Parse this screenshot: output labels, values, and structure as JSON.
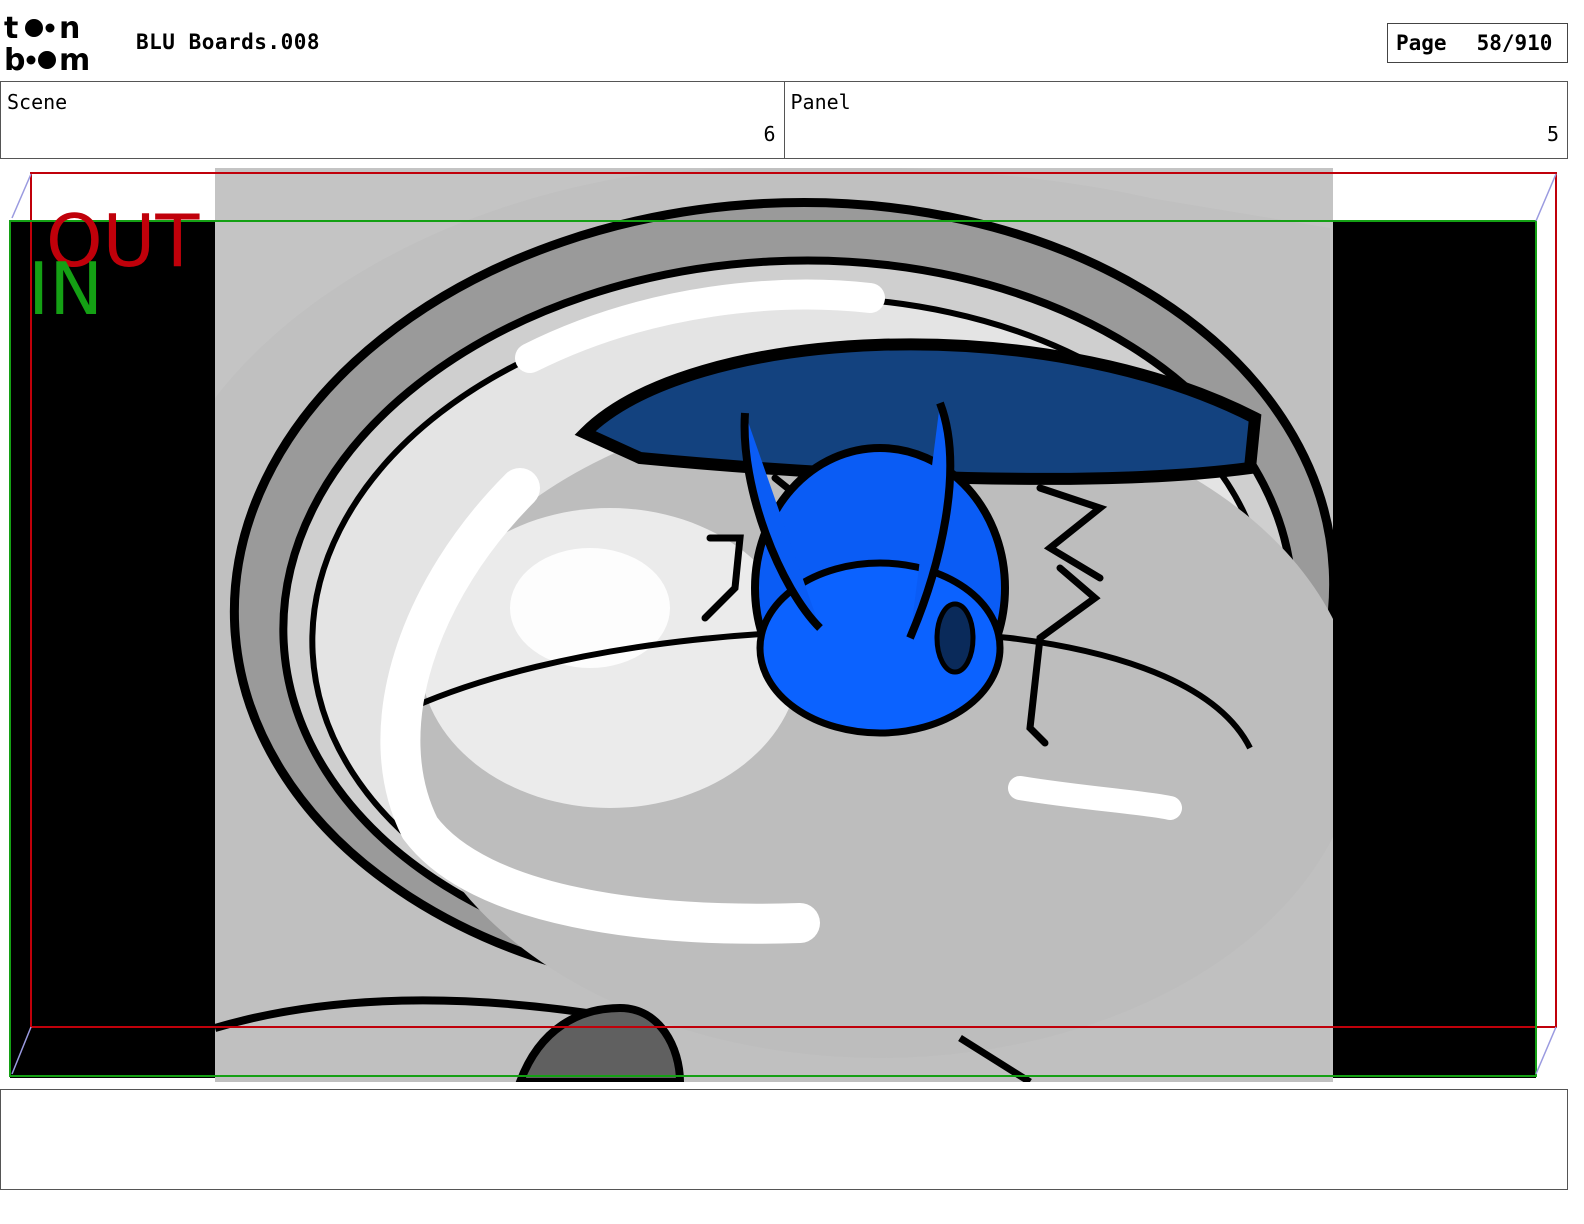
{
  "header": {
    "logo_alt": "toon boom",
    "title": "BLU Boards.008",
    "page_label": "Page",
    "page_value": "58/910"
  },
  "info": {
    "scene_label": "Scene",
    "scene_value": "6",
    "panel_label": "Panel",
    "panel_value": "5"
  },
  "frame_labels": {
    "out": "OUT",
    "in": "IN"
  },
  "colors": {
    "out_frame": "#c0000a",
    "in_frame": "#14a014",
    "character_blue": "#0a5cf5",
    "water_blue": "#13427f"
  },
  "notes": {
    "text": ""
  }
}
